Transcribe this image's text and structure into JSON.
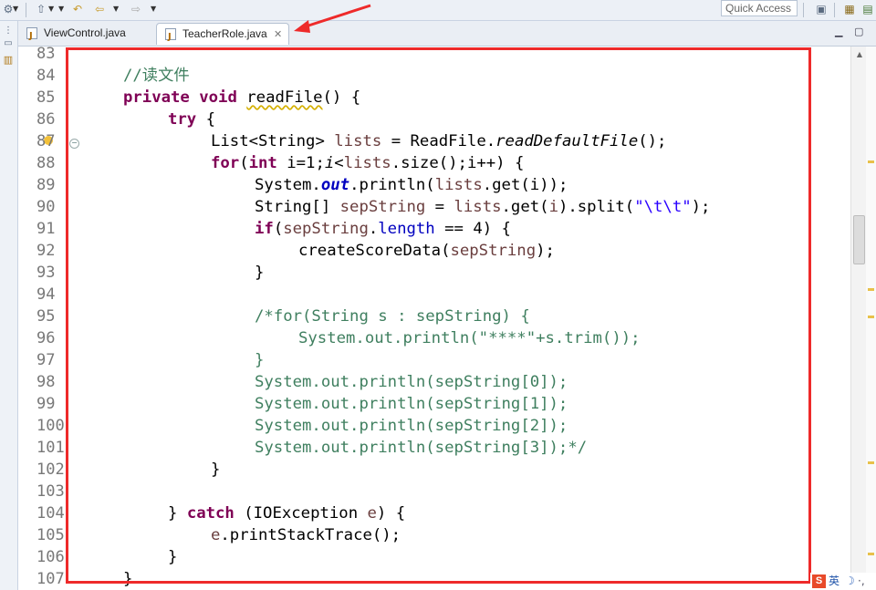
{
  "toolbar": {
    "quick_access_placeholder": "Quick Access"
  },
  "tabs": [
    {
      "label": "ViewControl.java",
      "active": false
    },
    {
      "label": "TeacherRole.java",
      "active": true
    }
  ],
  "line_numbers": [
    "83",
    "84",
    "85",
    "86",
    "87",
    "88",
    "89",
    "90",
    "91",
    "92",
    "93",
    "94",
    "95",
    "96",
    "97",
    "98",
    "99",
    "100",
    "101",
    "102",
    "103",
    "104",
    "105",
    "106",
    "107"
  ],
  "code": {
    "l84": "//读文件",
    "l85a": "private",
    "l85b": "void",
    "l85c": "readFile",
    "l85d": "() {",
    "l86a": "try",
    "l86b": " {",
    "l87a": "List<String> ",
    "l87b": "lists",
    "l87c": " = ReadFile.",
    "l87d": "readDefaultFile",
    "l87e": "();",
    "l88a": "for",
    "l88b": "(",
    "l88c": "int",
    "l88d": " i=1;",
    "l88e": "i",
    "l88f": "<",
    "l88g": "lists",
    "l88h": ".size();i++) {",
    "l89a": "System.",
    "l89b": "out",
    "l89c": ".println(",
    "l89d": "lists",
    "l89e": ".get(i));",
    "l90a": "String[] ",
    "l90b": "sepString",
    "l90c": " = ",
    "l90d": "lists",
    "l90e": ".get(",
    "l90f": "i",
    "l90g": ").split(",
    "l90h": "\"\\t\\t\"",
    "l90i": ");",
    "l91a": "if",
    "l91b": "(",
    "l91c": "sepString",
    "l91d": ".",
    "l91e": "length",
    "l91f": " == 4) {",
    "l92a": "createScoreData(",
    "l92b": "sepString",
    "l92c": ");",
    "l93": "}",
    "l95": "/*for(String s : sepString) {",
    "l96": "System.out.println(\"****\"+s.trim());",
    "l97": "}",
    "l98": "System.out.println(sepString[0]);",
    "l99": "System.out.println(sepString[1]);",
    "l100": "System.out.println(sepString[2]);",
    "l101": "System.out.println(sepString[3]);*/",
    "l102": "}",
    "l104a": "} ",
    "l104b": "catch",
    "l104c": " (IOException ",
    "l104d": "e",
    "l104e": ") {",
    "l105a": "e",
    "l105b": ".printStackTrace();",
    "l106": "}",
    "l107": "}"
  },
  "status": {
    "ime_label": "英"
  },
  "colors": {
    "annotation_red": "#ee2a2a",
    "keyword": "#7f0055",
    "comment": "#3f7f5f",
    "field": "#0000c0",
    "local_var": "#6a3e3e",
    "string": "#2a00ff"
  }
}
